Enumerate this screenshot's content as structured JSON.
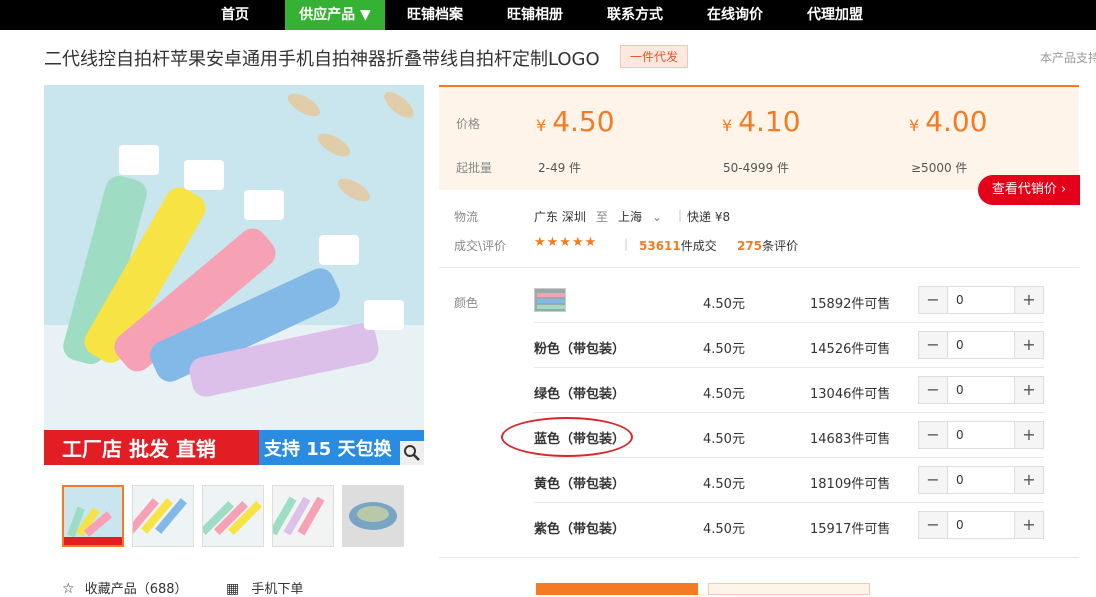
{
  "nav": {
    "items": [
      {
        "label": "首页"
      },
      {
        "label": "供应产品 ▼"
      },
      {
        "label": "旺铺档案"
      },
      {
        "label": "旺铺相册"
      },
      {
        "label": "联系方式"
      },
      {
        "label": "在线询价"
      },
      {
        "label": "代理加盟"
      }
    ]
  },
  "product": {
    "title": "二代线控自拍杆苹果安卓通用手机自拍神器折叠带线自拍杆定制LOGO",
    "badge": "一件代发",
    "support_text": "本产品支持"
  },
  "gallery": {
    "main_image_text": "工厂店 批发 直销",
    "main_image_banner": "支持 15 天包换",
    "favorite": "收藏产品（688）",
    "mobile_order": "手机下单"
  },
  "pricing": {
    "price_label": "价格",
    "moq_label": "起批量",
    "tiers": [
      {
        "price": "4.50",
        "range": "2-49 件"
      },
      {
        "price": "4.10",
        "range": "50-4999 件"
      },
      {
        "price": "4.00",
        "range": "≥5000 件"
      }
    ],
    "currency": "¥",
    "distribution_button": "查看代销价 ›"
  },
  "logistics": {
    "label": "物流",
    "from": "广东 深圳",
    "to_word": "至",
    "to": "上海",
    "express": "快递 ¥8"
  },
  "deals": {
    "label": "成交\\评价",
    "stars": "★★★★★",
    "sold_count": "53611",
    "sold_suffix": "件成交",
    "review_count": "275",
    "review_suffix": "条评价"
  },
  "variants": {
    "label": "颜色",
    "rows": [
      {
        "name": "",
        "price": "4.50元",
        "stock": "15892件可售",
        "qty": "0"
      },
      {
        "name": "粉色（带包装）",
        "price": "4.50元",
        "stock": "14526件可售",
        "qty": "0"
      },
      {
        "name": "绿色（带包装）",
        "price": "4.50元",
        "stock": "13046件可售",
        "qty": "0"
      },
      {
        "name": "蓝色（带包装）",
        "price": "4.50元",
        "stock": "14683件可售",
        "qty": "0"
      },
      {
        "name": "黄色（带包装）",
        "price": "4.50元",
        "stock": "18109件可售",
        "qty": "0"
      },
      {
        "name": "紫色（带包装）",
        "price": "4.50元",
        "stock": "15917件可售",
        "qty": "0"
      }
    ]
  },
  "colors": {
    "accent": "#f47b22",
    "nav_active": "#35b233",
    "red": "#e5001a"
  }
}
